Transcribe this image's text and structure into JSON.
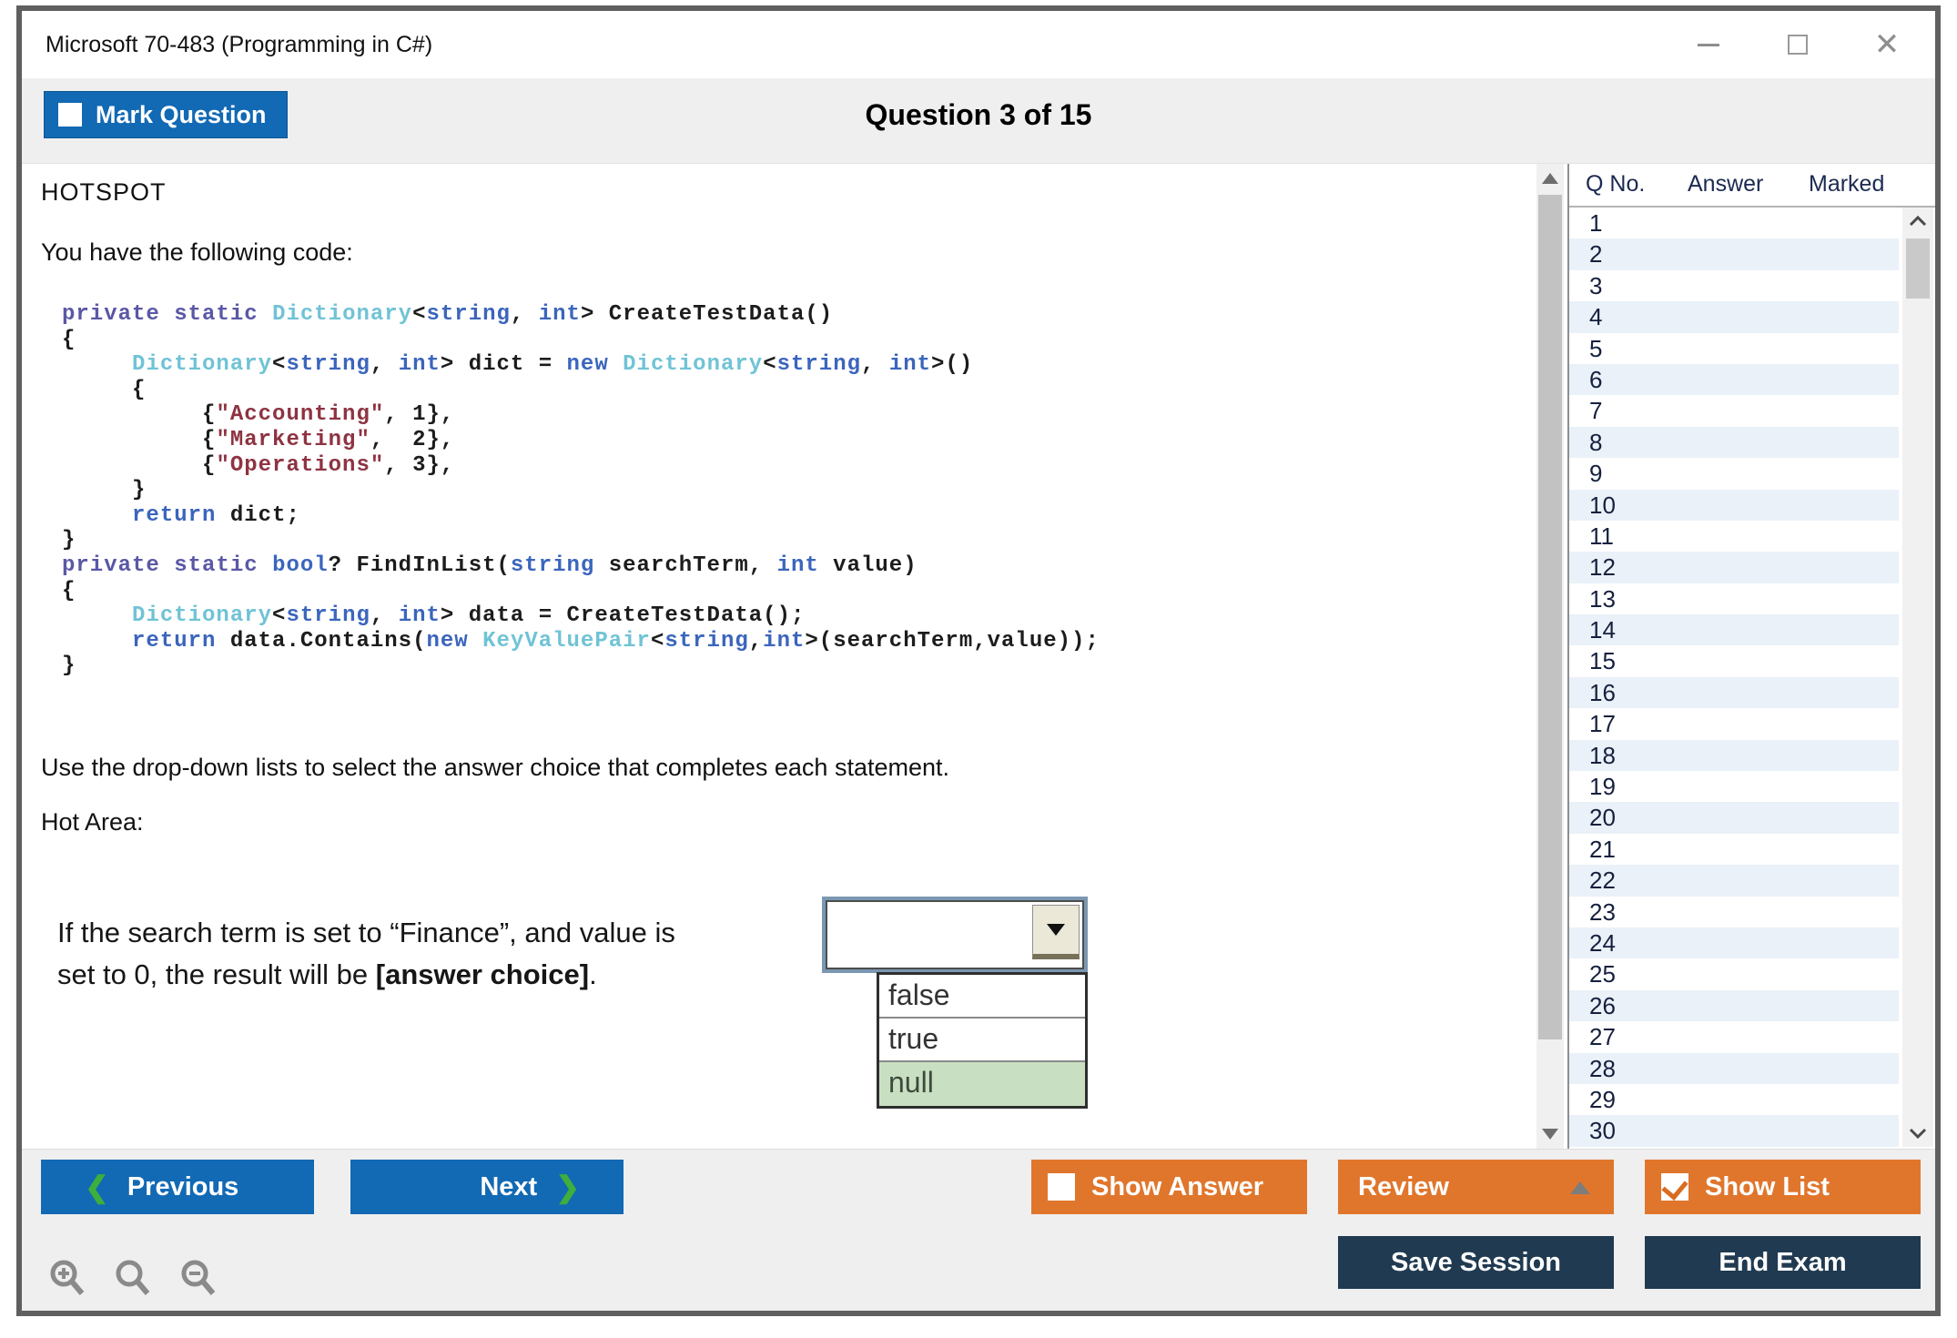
{
  "window": {
    "title": "Microsoft 70-483 (Programming in C#)"
  },
  "header": {
    "mark_question_label": "Mark Question",
    "question_counter": "Question 3 of 15"
  },
  "question": {
    "type_label": "HOTSPOT",
    "intro": "You have the following code:",
    "instruction": "Use the drop-down lists to select the answer choice that completes each statement.",
    "hot_area_label": "Hot Area:",
    "statement_line1": "If the search term is set to “Finance”, and value is",
    "statement_line2_prefix": "set to 0, the result will be ",
    "statement_line2_bold": "[answer choice]",
    "statement_line2_suffix": ".",
    "dropdown": {
      "selected_value": "",
      "options": [
        "false",
        "true",
        "null"
      ],
      "highlighted_option": "null",
      "highlight_color": "#c9dfc1"
    }
  },
  "code": {
    "lines": [
      [
        [
          "k1",
          "private"
        ],
        [
          "pl",
          " "
        ],
        [
          "k1",
          "static"
        ],
        [
          "pl",
          " "
        ],
        [
          "ty",
          "Dictionary"
        ],
        [
          "pl",
          "<"
        ],
        [
          "k2",
          "string"
        ],
        [
          "pl",
          ", "
        ],
        [
          "k2",
          "int"
        ],
        [
          "pl",
          "> CreateTestData()"
        ]
      ],
      [
        [
          "pl",
          "{"
        ]
      ],
      [
        [
          "pl",
          "     "
        ],
        [
          "ty",
          "Dictionary"
        ],
        [
          "pl",
          "<"
        ],
        [
          "k2",
          "string"
        ],
        [
          "pl",
          ", "
        ],
        [
          "k2",
          "int"
        ],
        [
          "pl",
          "> dict = "
        ],
        [
          "k2",
          "new"
        ],
        [
          "pl",
          " "
        ],
        [
          "ty",
          "Dictionary"
        ],
        [
          "pl",
          "<"
        ],
        [
          "k2",
          "string"
        ],
        [
          "pl",
          ", "
        ],
        [
          "k2",
          "int"
        ],
        [
          "pl",
          ">()"
        ]
      ],
      [
        [
          "pl",
          "     {"
        ]
      ],
      [
        [
          "pl",
          "          {"
        ],
        [
          "st",
          "\"Accounting\""
        ],
        [
          "pl",
          ", 1},"
        ]
      ],
      [
        [
          "pl",
          "          {"
        ],
        [
          "st",
          "\"Marketing\""
        ],
        [
          "pl",
          ",  2},"
        ]
      ],
      [
        [
          "pl",
          "          {"
        ],
        [
          "st",
          "\"Operations\""
        ],
        [
          "pl",
          ", 3},"
        ]
      ],
      [
        [
          "pl",
          "     }"
        ]
      ],
      [
        [
          "pl",
          "     "
        ],
        [
          "k2",
          "return"
        ],
        [
          "pl",
          " dict;"
        ]
      ],
      [
        [
          "pl",
          "}"
        ]
      ],
      [
        [
          "k1",
          "private"
        ],
        [
          "pl",
          " "
        ],
        [
          "k1",
          "static"
        ],
        [
          "pl",
          " "
        ],
        [
          "k2",
          "bool"
        ],
        [
          "pl",
          "? FindInList("
        ],
        [
          "k2",
          "string"
        ],
        [
          "pl",
          " searchTerm, "
        ],
        [
          "k2",
          "int"
        ],
        [
          "pl",
          " value)"
        ]
      ],
      [
        [
          "pl",
          "{"
        ]
      ],
      [
        [
          "pl",
          "     "
        ],
        [
          "ty",
          "Dictionary"
        ],
        [
          "pl",
          "<"
        ],
        [
          "k2",
          "string"
        ],
        [
          "pl",
          ", "
        ],
        [
          "k2",
          "int"
        ],
        [
          "pl",
          "> data = CreateTestData();"
        ]
      ],
      [
        [
          "pl",
          "     "
        ],
        [
          "k2",
          "return"
        ],
        [
          "pl",
          " data.Contains("
        ],
        [
          "k2",
          "new"
        ],
        [
          "pl",
          " "
        ],
        [
          "ty",
          "KeyValuePair"
        ],
        [
          "pl",
          "<"
        ],
        [
          "k2",
          "string"
        ],
        [
          "pl",
          ","
        ],
        [
          "k2",
          "int"
        ],
        [
          "pl",
          ">(searchTerm,value));"
        ]
      ],
      [
        [
          "pl",
          "}"
        ]
      ]
    ]
  },
  "sidebar": {
    "columns": [
      "Q No.",
      "Answer",
      "Marked"
    ],
    "rows": [
      "1",
      "2",
      "3",
      "4",
      "5",
      "6",
      "7",
      "8",
      "9",
      "10",
      "11",
      "12",
      "13",
      "14",
      "15",
      "16",
      "17",
      "18",
      "19",
      "20",
      "21",
      "22",
      "23",
      "24",
      "25",
      "26",
      "27",
      "28",
      "29",
      "30"
    ]
  },
  "footer": {
    "previous_label": "Previous",
    "next_label": "Next",
    "show_answer_label": "Show Answer",
    "review_label": "Review",
    "show_list_label": "Show List",
    "save_session_label": "Save Session",
    "end_exam_label": "End Exam"
  },
  "colors": {
    "primary_blue": "#1269b4",
    "accent_orange": "#e0762c",
    "dark_navy": "#203a51",
    "chevron_green": "#3eae3c",
    "row_alt_blue": "#eaf1f8",
    "option_highlight_green": "#c9dfc1"
  }
}
